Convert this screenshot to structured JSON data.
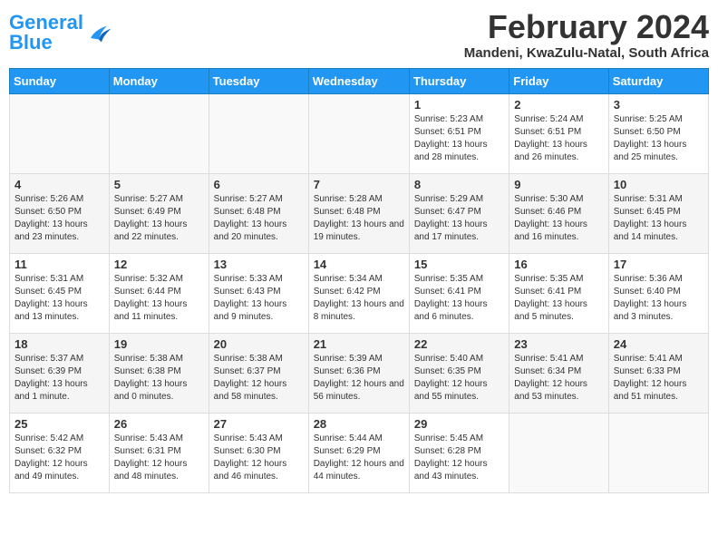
{
  "header": {
    "logo_general": "General",
    "logo_blue": "Blue",
    "title": "February 2024",
    "subtitle": "Mandeni, KwaZulu-Natal, South Africa"
  },
  "columns": [
    "Sunday",
    "Monday",
    "Tuesday",
    "Wednesday",
    "Thursday",
    "Friday",
    "Saturday"
  ],
  "weeks": [
    [
      {
        "day": "",
        "info": ""
      },
      {
        "day": "",
        "info": ""
      },
      {
        "day": "",
        "info": ""
      },
      {
        "day": "",
        "info": ""
      },
      {
        "day": "1",
        "info": "Sunrise: 5:23 AM\nSunset: 6:51 PM\nDaylight: 13 hours and 28 minutes."
      },
      {
        "day": "2",
        "info": "Sunrise: 5:24 AM\nSunset: 6:51 PM\nDaylight: 13 hours and 26 minutes."
      },
      {
        "day": "3",
        "info": "Sunrise: 5:25 AM\nSunset: 6:50 PM\nDaylight: 13 hours and 25 minutes."
      }
    ],
    [
      {
        "day": "4",
        "info": "Sunrise: 5:26 AM\nSunset: 6:50 PM\nDaylight: 13 hours and 23 minutes."
      },
      {
        "day": "5",
        "info": "Sunrise: 5:27 AM\nSunset: 6:49 PM\nDaylight: 13 hours and 22 minutes."
      },
      {
        "day": "6",
        "info": "Sunrise: 5:27 AM\nSunset: 6:48 PM\nDaylight: 13 hours and 20 minutes."
      },
      {
        "day": "7",
        "info": "Sunrise: 5:28 AM\nSunset: 6:48 PM\nDaylight: 13 hours and 19 minutes."
      },
      {
        "day": "8",
        "info": "Sunrise: 5:29 AM\nSunset: 6:47 PM\nDaylight: 13 hours and 17 minutes."
      },
      {
        "day": "9",
        "info": "Sunrise: 5:30 AM\nSunset: 6:46 PM\nDaylight: 13 hours and 16 minutes."
      },
      {
        "day": "10",
        "info": "Sunrise: 5:31 AM\nSunset: 6:45 PM\nDaylight: 13 hours and 14 minutes."
      }
    ],
    [
      {
        "day": "11",
        "info": "Sunrise: 5:31 AM\nSunset: 6:45 PM\nDaylight: 13 hours and 13 minutes."
      },
      {
        "day": "12",
        "info": "Sunrise: 5:32 AM\nSunset: 6:44 PM\nDaylight: 13 hours and 11 minutes."
      },
      {
        "day": "13",
        "info": "Sunrise: 5:33 AM\nSunset: 6:43 PM\nDaylight: 13 hours and 9 minutes."
      },
      {
        "day": "14",
        "info": "Sunrise: 5:34 AM\nSunset: 6:42 PM\nDaylight: 13 hours and 8 minutes."
      },
      {
        "day": "15",
        "info": "Sunrise: 5:35 AM\nSunset: 6:41 PM\nDaylight: 13 hours and 6 minutes."
      },
      {
        "day": "16",
        "info": "Sunrise: 5:35 AM\nSunset: 6:41 PM\nDaylight: 13 hours and 5 minutes."
      },
      {
        "day": "17",
        "info": "Sunrise: 5:36 AM\nSunset: 6:40 PM\nDaylight: 13 hours and 3 minutes."
      }
    ],
    [
      {
        "day": "18",
        "info": "Sunrise: 5:37 AM\nSunset: 6:39 PM\nDaylight: 13 hours and 1 minute."
      },
      {
        "day": "19",
        "info": "Sunrise: 5:38 AM\nSunset: 6:38 PM\nDaylight: 13 hours and 0 minutes."
      },
      {
        "day": "20",
        "info": "Sunrise: 5:38 AM\nSunset: 6:37 PM\nDaylight: 12 hours and 58 minutes."
      },
      {
        "day": "21",
        "info": "Sunrise: 5:39 AM\nSunset: 6:36 PM\nDaylight: 12 hours and 56 minutes."
      },
      {
        "day": "22",
        "info": "Sunrise: 5:40 AM\nSunset: 6:35 PM\nDaylight: 12 hours and 55 minutes."
      },
      {
        "day": "23",
        "info": "Sunrise: 5:41 AM\nSunset: 6:34 PM\nDaylight: 12 hours and 53 minutes."
      },
      {
        "day": "24",
        "info": "Sunrise: 5:41 AM\nSunset: 6:33 PM\nDaylight: 12 hours and 51 minutes."
      }
    ],
    [
      {
        "day": "25",
        "info": "Sunrise: 5:42 AM\nSunset: 6:32 PM\nDaylight: 12 hours and 49 minutes."
      },
      {
        "day": "26",
        "info": "Sunrise: 5:43 AM\nSunset: 6:31 PM\nDaylight: 12 hours and 48 minutes."
      },
      {
        "day": "27",
        "info": "Sunrise: 5:43 AM\nSunset: 6:30 PM\nDaylight: 12 hours and 46 minutes."
      },
      {
        "day": "28",
        "info": "Sunrise: 5:44 AM\nSunset: 6:29 PM\nDaylight: 12 hours and 44 minutes."
      },
      {
        "day": "29",
        "info": "Sunrise: 5:45 AM\nSunset: 6:28 PM\nDaylight: 12 hours and 43 minutes."
      },
      {
        "day": "",
        "info": ""
      },
      {
        "day": "",
        "info": ""
      }
    ]
  ]
}
